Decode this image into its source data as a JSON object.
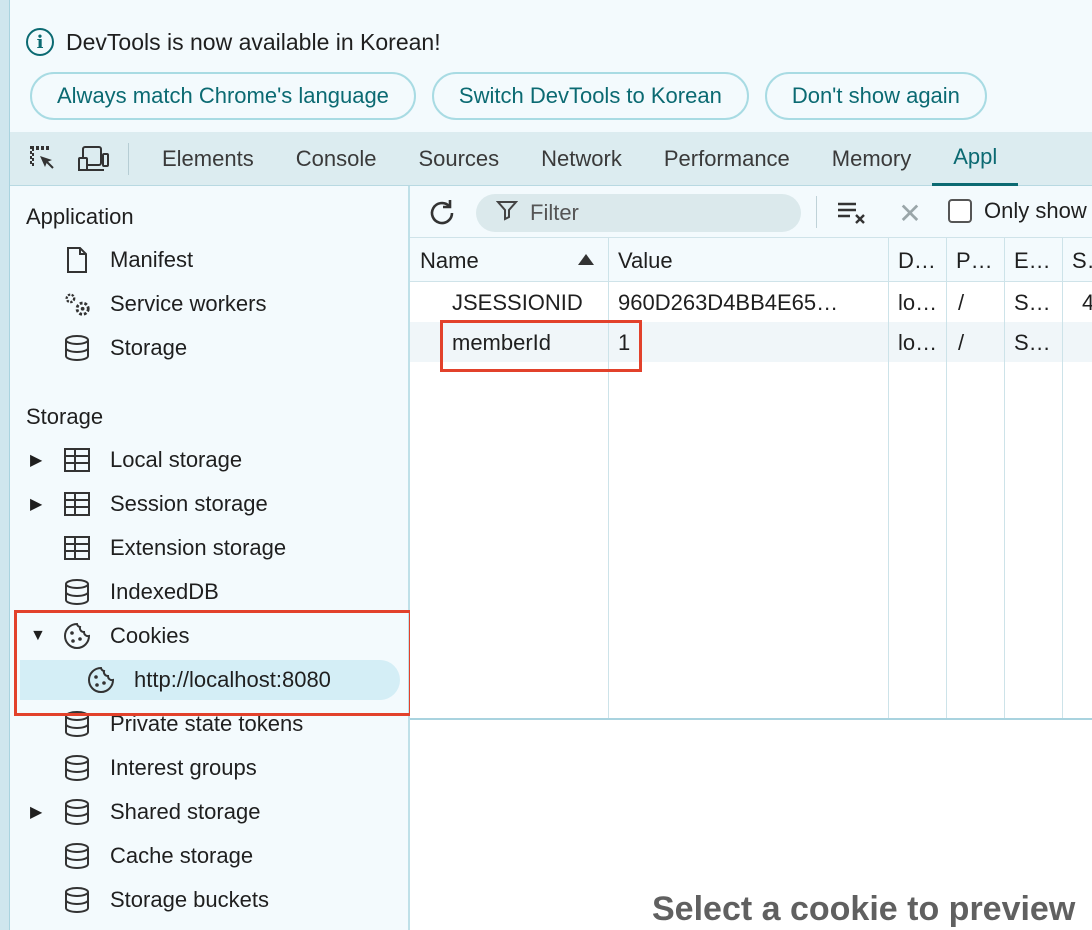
{
  "infobar": {
    "message": "DevTools is now available in Korean!",
    "buttons": [
      "Always match Chrome's language",
      "Switch DevTools to Korean",
      "Don't show again"
    ]
  },
  "tabs": [
    "Elements",
    "Console",
    "Sources",
    "Network",
    "Performance",
    "Memory",
    "Appl"
  ],
  "active_tab": "Appl",
  "sidebar": {
    "application_title": "Application",
    "application_items": [
      {
        "label": "Manifest",
        "icon": "document-icon"
      },
      {
        "label": "Service workers",
        "icon": "gears-icon"
      },
      {
        "label": "Storage",
        "icon": "database-icon"
      }
    ],
    "storage_title": "Storage",
    "storage_items": [
      {
        "label": "Local storage",
        "icon": "table-icon",
        "expander": "collapsed"
      },
      {
        "label": "Session storage",
        "icon": "table-icon",
        "expander": "collapsed"
      },
      {
        "label": "Extension storage",
        "icon": "table-icon"
      },
      {
        "label": "IndexedDB",
        "icon": "database-icon"
      },
      {
        "label": "Cookies",
        "icon": "cookie-icon",
        "expander": "expanded"
      },
      {
        "label": "http://localhost:8080",
        "icon": "cookie-icon",
        "selected": true
      },
      {
        "label": "Private state tokens",
        "icon": "database-icon"
      },
      {
        "label": "Interest groups",
        "icon": "database-icon"
      },
      {
        "label": "Shared storage",
        "icon": "database-icon",
        "expander": "collapsed"
      },
      {
        "label": "Cache storage",
        "icon": "database-icon"
      },
      {
        "label": "Storage buckets",
        "icon": "database-icon"
      }
    ]
  },
  "toolbar": {
    "filter_placeholder": "Filter",
    "only_show_label": "Only show"
  },
  "cookie_table": {
    "columns": [
      "Name",
      "Value",
      "D…",
      "P…",
      "E…",
      "S…"
    ],
    "rows": [
      {
        "name": "JSESSIONID",
        "value": "960D263D4BB4E65…",
        "domain": "lo…",
        "path": "/",
        "expires": "S…",
        "size": "4"
      },
      {
        "name": "memberId",
        "value": "1",
        "domain": "lo…",
        "path": "/",
        "expires": "S…",
        "size": ""
      }
    ]
  },
  "preview_text": "Select a cookie to preview",
  "colors": {
    "accent": "#0b6a72",
    "highlight": "#e2412b",
    "selected_bg": "#d4eef6"
  }
}
